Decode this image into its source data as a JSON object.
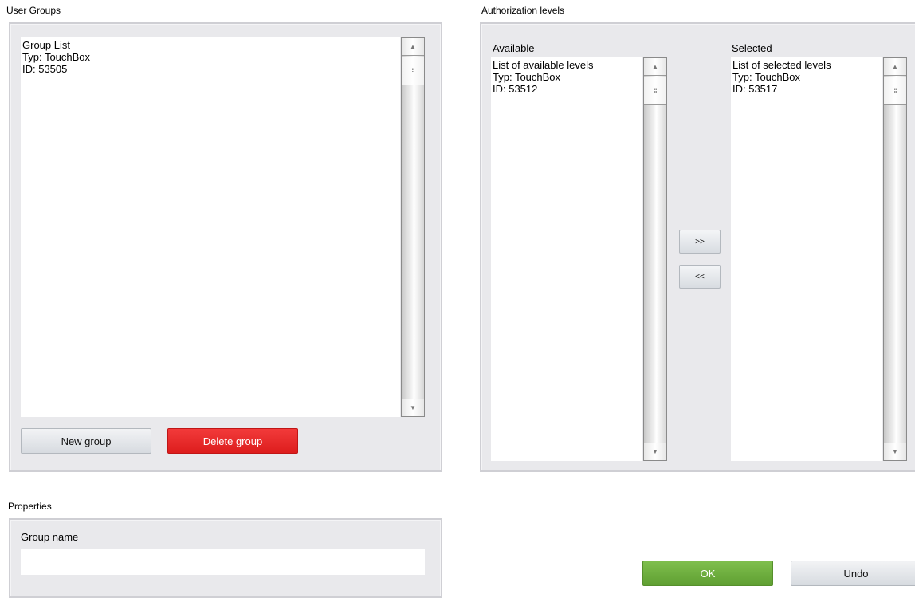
{
  "user_groups": {
    "title": "User Groups",
    "list_items": [
      "Group List",
      "Typ: TouchBox",
      "ID: 53505"
    ],
    "new_button": "New group",
    "delete_button": "Delete group"
  },
  "authorization": {
    "title": "Authorization levels",
    "available_label": "Available",
    "available_items": [
      "List of available levels",
      "Typ: TouchBox",
      "ID: 53512"
    ],
    "selected_label": "Selected",
    "selected_items": [
      "List of selected levels",
      "Typ: TouchBox",
      "ID: 53517"
    ],
    "add_button": ">>",
    "remove_button": "<<"
  },
  "properties": {
    "title": "Properties",
    "group_name_label": "Group name",
    "group_name_value": ""
  },
  "footer": {
    "ok_button": "OK",
    "undo_button": "Undo"
  },
  "colors": {
    "accent_green": "#6aaa3c",
    "danger_red": "#e82626",
    "panel_bg": "#e9e9ec"
  },
  "icons": {
    "scroll_up": "▲",
    "scroll_down": "▼",
    "thumb_grip": "⁞⁞"
  }
}
